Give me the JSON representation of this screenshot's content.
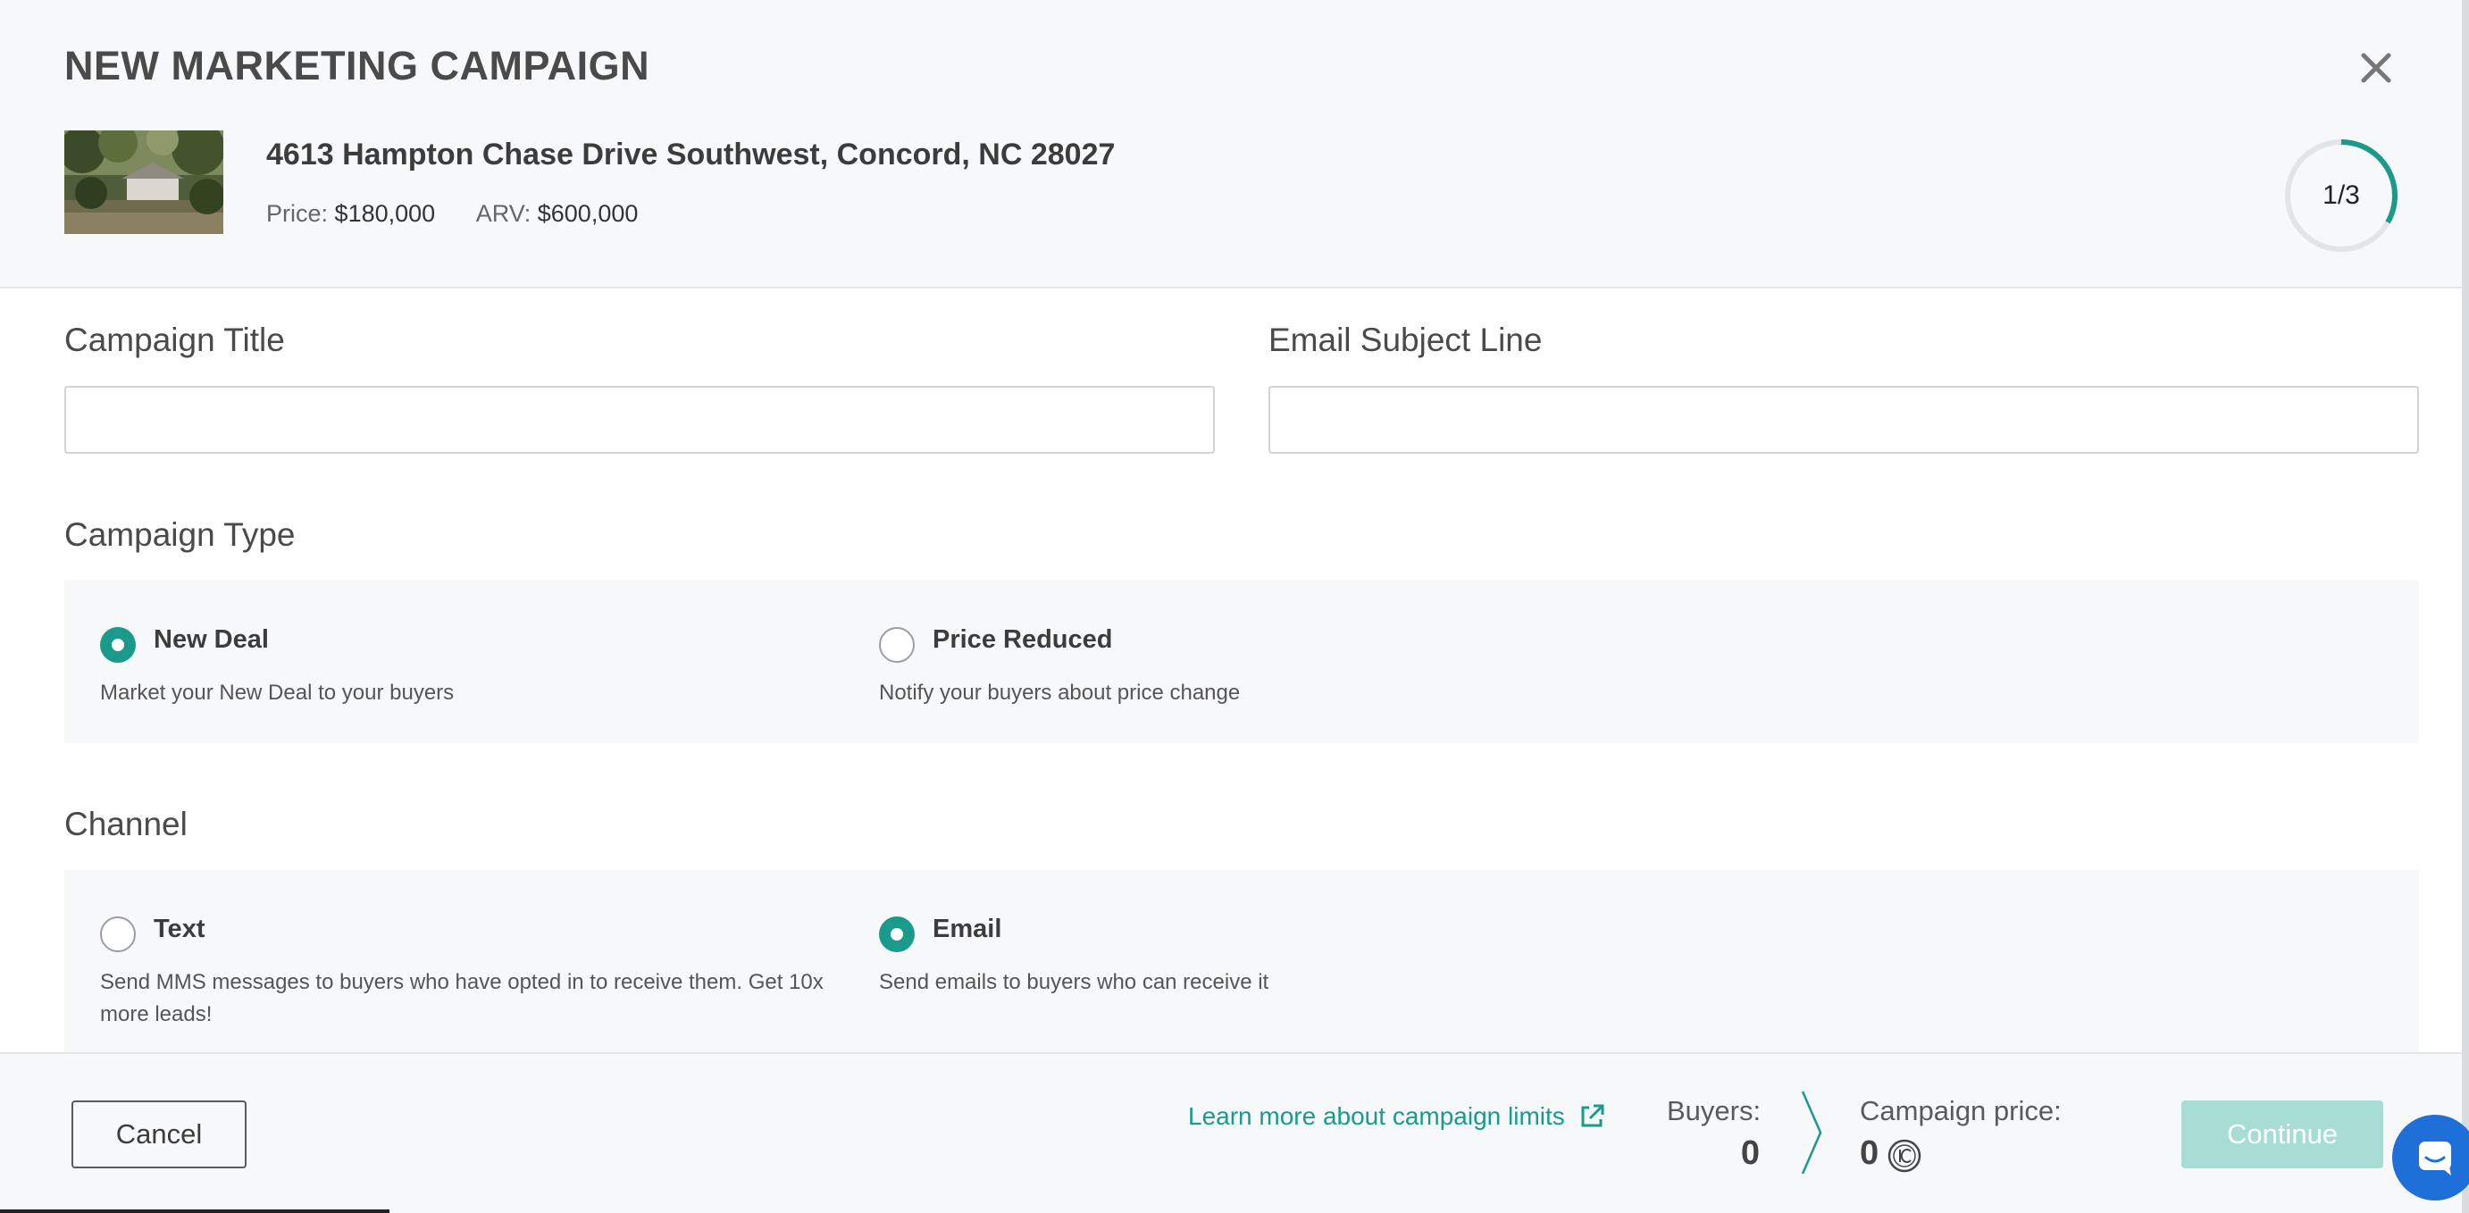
{
  "modal": {
    "title": "NEW MARKETING CAMPAIGN",
    "close_icon": "close-icon",
    "step_indicator": "1/3",
    "step_progress_fraction": 0.333
  },
  "property": {
    "address": "4613 Hampton Chase Drive Southwest, Concord, NC 28027",
    "price_label": "Price:",
    "price_value": "$180,000",
    "arv_label": "ARV:",
    "arv_value": "$600,000"
  },
  "form": {
    "campaign_title_label": "Campaign Title",
    "campaign_title_value": "",
    "email_subject_label": "Email Subject Line",
    "email_subject_value": "",
    "campaign_type_heading": "Campaign Type",
    "campaign_types": [
      {
        "label": "New Deal",
        "description": "Market your New Deal to your buyers",
        "selected": true
      },
      {
        "label": "Price Reduced",
        "description": "Notify your buyers about price change",
        "selected": false
      }
    ],
    "channel_heading": "Channel",
    "channels": [
      {
        "label": "Text",
        "description": "Send MMS messages to buyers who have opted in to receive them. Get 10x more leads!",
        "selected": false
      },
      {
        "label": "Email",
        "description": "Send emails to buyers who can receive it",
        "selected": true
      }
    ]
  },
  "footer": {
    "cancel_label": "Cancel",
    "learn_more_label": "Learn more about campaign limits",
    "buyers_label": "Buyers:",
    "buyers_value": "0",
    "campaign_price_label": "Campaign price:",
    "campaign_price_value": "0",
    "continue_label": "Continue"
  },
  "colors": {
    "accent": "#1a9a8b",
    "continue_disabled": "#a8ddd6",
    "chat_launcher": "#1f6fd8",
    "panel_bg": "#f7f8fa"
  }
}
